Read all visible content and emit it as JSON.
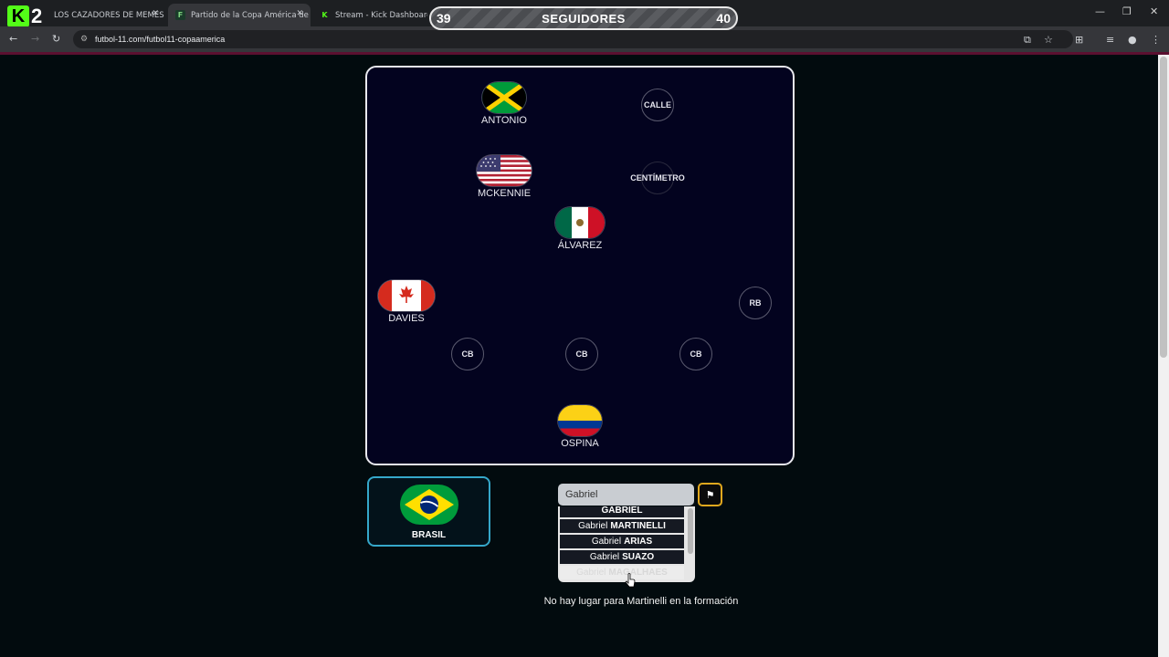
{
  "browser": {
    "tabs": [
      {
        "title": "LOS CAZADORES DE MEMES | I"
      },
      {
        "title": "Partido de la Copa América de"
      },
      {
        "title": "Stream - Kick Dashboard"
      }
    ],
    "url": "futbol-11.com/futbol11-copaamerica"
  },
  "overlay": {
    "logo_text": "2",
    "followers_label": "SEGUIDORES",
    "current": "39",
    "goal": "40"
  },
  "pitch": {
    "players": [
      {
        "name": "ANTONIO",
        "flag": "jamaica-flag"
      },
      {
        "name": "MCKENNIE",
        "flag": "usa-flag"
      },
      {
        "name": "ÁLVAREZ",
        "flag": "mexico-flag"
      },
      {
        "name": "DAVIES",
        "flag": "canada-flag"
      },
      {
        "name": "OSPINA",
        "flag": "colombia-flag"
      }
    ],
    "slots": [
      "CALLE",
      "CENTÍMETRO",
      "RB",
      "CB",
      "CB",
      "CB"
    ]
  },
  "team": {
    "name": "BRASIL",
    "flag": "brazil-flag"
  },
  "search": {
    "value": "Gabriel",
    "results": [
      {
        "first": "GABRIEL",
        "last": ""
      },
      {
        "first": "Gabriel",
        "last": "MARTINELLI"
      },
      {
        "first": "Gabriel",
        "last": "ARIAS"
      },
      {
        "first": "Gabriel",
        "last": "SUAZO"
      },
      {
        "first": "Gabriel",
        "last": "MAGALHAES"
      }
    ]
  },
  "message": "No hay lugar para Martinelli en la formación"
}
